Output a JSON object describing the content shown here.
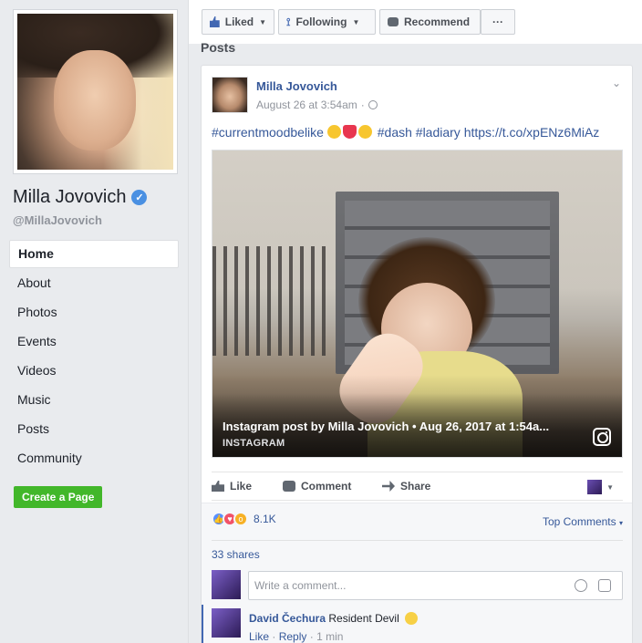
{
  "sidebar": {
    "page_name": "Milla Jovovich",
    "handle": "@MillaJovovich",
    "nav": [
      {
        "label": "Home"
      },
      {
        "label": "About"
      },
      {
        "label": "Photos"
      },
      {
        "label": "Events"
      },
      {
        "label": "Videos"
      },
      {
        "label": "Music"
      },
      {
        "label": "Posts"
      },
      {
        "label": "Community"
      }
    ],
    "create_page_label": "Create a Page"
  },
  "topbar": {
    "liked_label": "Liked",
    "following_label": "Following",
    "recommend_label": "Recommend",
    "more_label": "···"
  },
  "section_heading": "Posts",
  "post": {
    "author": "Milla Jovovich",
    "timestamp": "August 26 at 3:54am",
    "text_hashtag1": "#currentmoodbelike",
    "text_rest": "#dash #ladiary https://t.co/xpENz6MiAz",
    "media": {
      "title": "Instagram post by Milla Jovovich • Aug 26, 2017 at 1:54a...",
      "source": "INSTAGRAM"
    },
    "actions": {
      "like": "Like",
      "comment": "Comment",
      "share": "Share"
    },
    "reactions_count": "8.1K",
    "top_comments_label": "Top Comments",
    "shares": "33 shares",
    "comment_placeholder": "Write a comment...",
    "comment": {
      "author": "David Čechura",
      "text": "Resident Devil",
      "like": "Like",
      "reply": "Reply",
      "time": "1 min"
    }
  },
  "colors": {
    "link": "#365899",
    "create_page_green": "#42b72a",
    "verified_blue": "#4a90e2"
  }
}
